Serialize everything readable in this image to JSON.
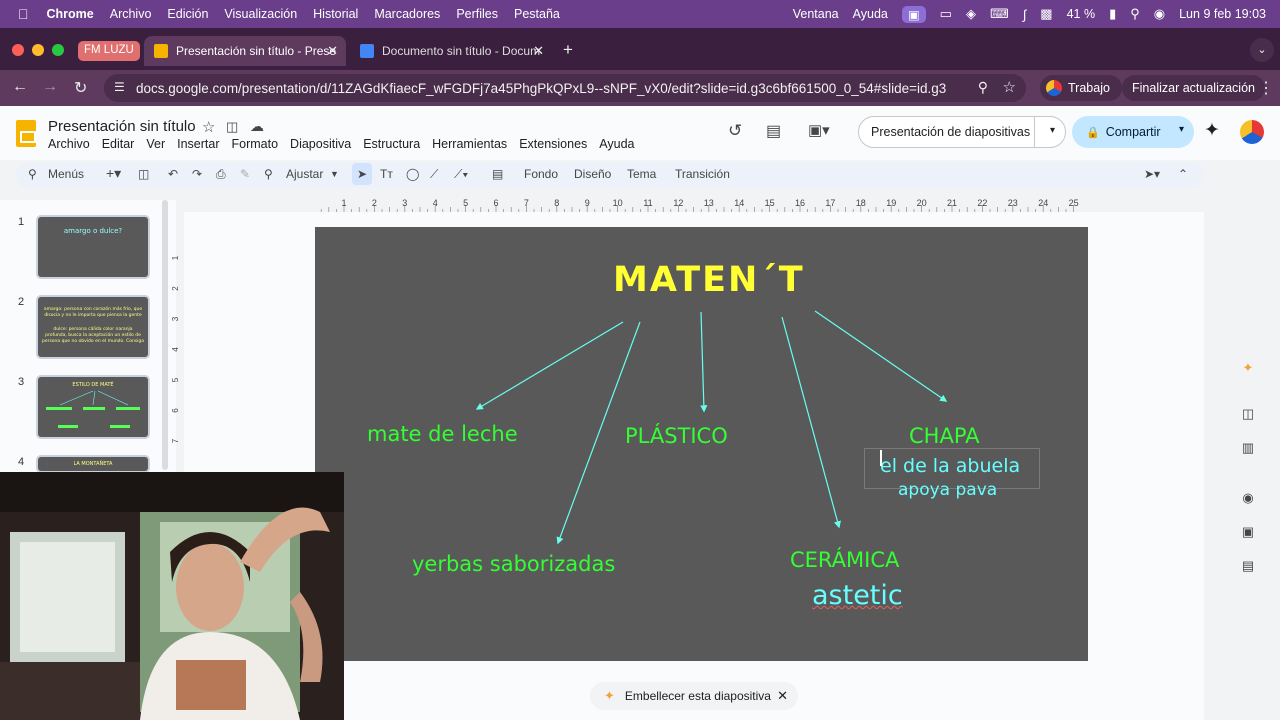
{
  "macos_menubar": {
    "app": "Chrome",
    "items": [
      "Archivo",
      "Edición",
      "Visualización",
      "Historial",
      "Marcadores",
      "Perfiles",
      "Pestaña"
    ],
    "right_items": [
      "Ventana",
      "Ayuda"
    ],
    "battery": "41 %",
    "datetime": "Lun 9 feb 19:03"
  },
  "browser": {
    "tab_group": "FM LUZU",
    "tabs": [
      {
        "title": "Presentación sin título - Prese",
        "active": true
      },
      {
        "title": "Documento sin título - Docum",
        "active": false
      }
    ],
    "url": "docs.google.com/presentation/d/11ZAGdKfiaecF_wFGDFj7a45PhgPkQPxL9--sNPF_vX0/edit?slide=id.g3c6bf661500_0_54#slide=id.g3c6bf6...",
    "profile_label": "Trabajo",
    "update_label": "Finalizar actualización"
  },
  "docs": {
    "title": "Presentación sin título",
    "menu": [
      "Archivo",
      "Editar",
      "Ver",
      "Insertar",
      "Formato",
      "Diapositiva",
      "Estructura",
      "Herramientas",
      "Extensiones",
      "Ayuda"
    ],
    "slideshow_label": "Presentación de diapositivas",
    "share_label": "Compartir"
  },
  "toolbar": {
    "menus_label": "Menús",
    "zoom_label": "Ajustar",
    "background_label": "Fondo",
    "layout_label": "Diseño",
    "theme_label": "Tema",
    "transition_label": "Transición"
  },
  "ruler": {
    "h_ticks": [
      "1",
      "2",
      "3",
      "4",
      "5",
      "6",
      "7",
      "8",
      "9",
      "10",
      "11",
      "12",
      "13",
      "14",
      "15",
      "16",
      "17",
      "18",
      "19",
      "20",
      "21",
      "22",
      "23",
      "24",
      "25"
    ],
    "v_ticks": [
      "1",
      "2",
      "3",
      "4",
      "5",
      "6",
      "7",
      "8"
    ]
  },
  "filmstrip": [
    {
      "number": "1",
      "lines": [
        "amargo o dulce?"
      ]
    },
    {
      "number": "2",
      "lines": [
        "amargo: persona con corazón más frío, que",
        "disocia y no le importa que piensa la gente",
        "dulce: persona cálida color naranja",
        "profunda, busca la aceptación un estilo de",
        "persona que no obvido en el mundo. Consiga"
      ]
    },
    {
      "number": "3",
      "lines": [
        "ESTILO DE MATÉ"
      ]
    },
    {
      "number": "4",
      "lines": [
        "LA MONTAÑETA"
      ]
    }
  ],
  "slide": {
    "title": "MATEN´T",
    "labels": {
      "mate_de_leche": "mate de leche",
      "plastico": "PLÁSTICO",
      "chapa": "CHAPA",
      "chapa_note_1": "el de la abuela",
      "chapa_note_2": "apoya pava",
      "yerbas": "yerbas saborizadas",
      "ceramica": "CERÁMICA",
      "ceramica_note": "astetic"
    },
    "colors": {
      "background": "#595959",
      "title": "#ffff33",
      "label_green": "#33ff33",
      "note_cyan": "#66ffff",
      "arrow": "#66ffee"
    }
  },
  "beautify": {
    "label": "Embellecer esta diapositiva"
  }
}
